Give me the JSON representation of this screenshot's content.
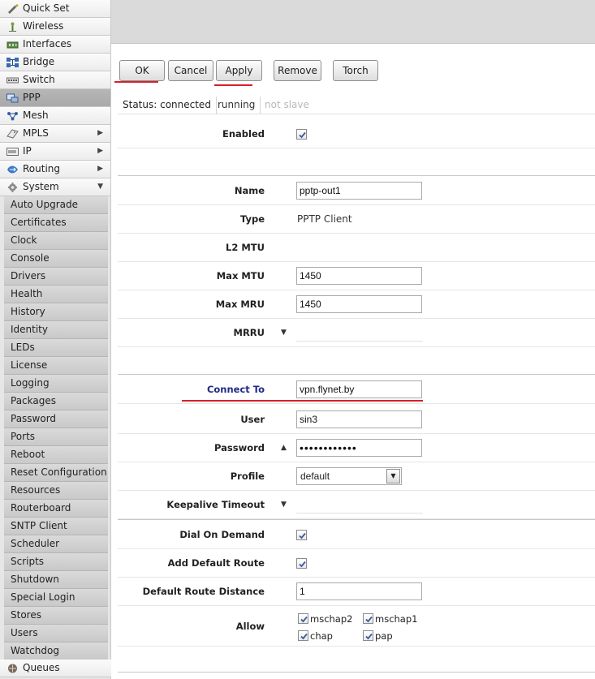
{
  "sidebar": {
    "items": [
      {
        "label": "Quick Set",
        "icon": "quick-set-icon",
        "arrow": ""
      },
      {
        "label": "Wireless",
        "icon": "wireless-icon",
        "arrow": ""
      },
      {
        "label": "Interfaces",
        "icon": "interfaces-icon",
        "arrow": ""
      },
      {
        "label": "Bridge",
        "icon": "bridge-icon",
        "arrow": ""
      },
      {
        "label": "Switch",
        "icon": "switch-icon",
        "arrow": ""
      },
      {
        "label": "PPP",
        "icon": "ppp-icon",
        "arrow": ""
      },
      {
        "label": "Mesh",
        "icon": "mesh-icon",
        "arrow": ""
      },
      {
        "label": "MPLS",
        "icon": "mpls-icon",
        "arrow": "▶"
      },
      {
        "label": "IP",
        "icon": "ip-icon",
        "arrow": "▶"
      },
      {
        "label": "Routing",
        "icon": "routing-icon",
        "arrow": "▶"
      },
      {
        "label": "System",
        "icon": "gear-icon",
        "arrow": "▼"
      }
    ],
    "system_submenu": [
      "Auto Upgrade",
      "Certificates",
      "Clock",
      "Console",
      "Drivers",
      "Health",
      "History",
      "Identity",
      "LEDs",
      "License",
      "Logging",
      "Packages",
      "Password",
      "Ports",
      "Reboot",
      "Reset Configuration",
      "Resources",
      "Routerboard",
      "SNTP Client",
      "Scheduler",
      "Scripts",
      "Shutdown",
      "Special Login",
      "Stores",
      "Users",
      "Watchdog"
    ],
    "queues": {
      "label": "Queues",
      "icon": "queues-icon"
    }
  },
  "toolbar": {
    "ok": "OK",
    "cancel": "Cancel",
    "apply": "Apply",
    "remove": "Remove",
    "torch": "Torch"
  },
  "status": {
    "status": "Status: connected",
    "running": "running",
    "slave": "not slave"
  },
  "form": {
    "enabled": {
      "label": "Enabled",
      "checked": true
    },
    "name": {
      "label": "Name",
      "value": "pptp-out1"
    },
    "type": {
      "label": "Type",
      "value": "PPTP Client"
    },
    "l2mtu": {
      "label": "L2 MTU"
    },
    "max_mtu": {
      "label": "Max MTU",
      "value": "1450"
    },
    "max_mru": {
      "label": "Max MRU",
      "value": "1450"
    },
    "mrru": {
      "label": "MRRU"
    },
    "connect_to": {
      "label": "Connect To",
      "value": "vpn.flynet.by"
    },
    "user": {
      "label": "User",
      "value": "sin3"
    },
    "password": {
      "label": "Password",
      "value": "••••••••••••"
    },
    "profile": {
      "label": "Profile",
      "value": "default"
    },
    "keepalive": {
      "label": "Keepalive Timeout"
    },
    "dial_on_demand": {
      "label": "Dial On Demand",
      "checked": true
    },
    "add_default_route": {
      "label": "Add Default Route",
      "checked": true
    },
    "default_route_distance": {
      "label": "Default Route Distance",
      "value": "1"
    },
    "allow": {
      "label": "Allow",
      "options": [
        {
          "label": "mschap2",
          "checked": true
        },
        {
          "label": "mschap1",
          "checked": true
        },
        {
          "label": "chap",
          "checked": true
        },
        {
          "label": "pap",
          "checked": true
        }
      ]
    }
  },
  "colors": {
    "annotation_red": "#d5212a",
    "highlight_label_blue": "#1f2a84"
  }
}
